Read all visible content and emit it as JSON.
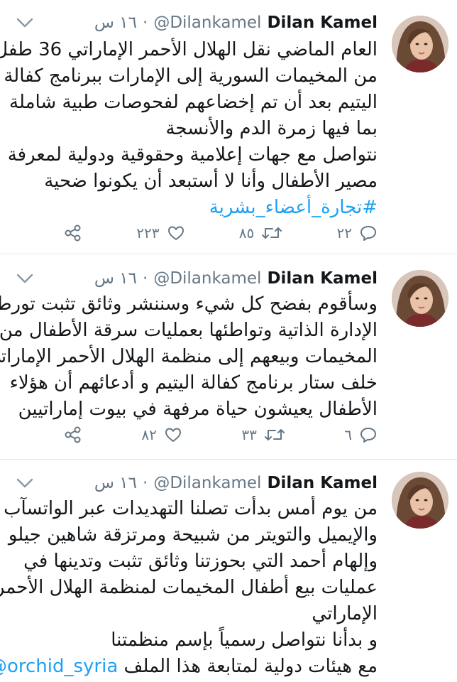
{
  "colors": {
    "link": "#1da1f2",
    "secondary_text": "#657786",
    "primary_text": "#14171a",
    "divider": "#e1e8ed"
  },
  "icons": {
    "reply": "reply-icon",
    "retweet": "retweet-icon",
    "like": "like-icon",
    "share": "share-icon",
    "caret": "chevron-down-icon"
  },
  "tweets": [
    {
      "display_name": "Dilan Kamel",
      "handle": "@Dilankamel",
      "dot": "·",
      "time": "١٦ س",
      "lines": [
        "العام الماضي نقل الهلال الأحمر الإماراتي 36 طفل",
        "من المخيمات السورية إلى الإمارات ببرنامج كفالة",
        "اليتيم بعد أن تم إخضاعهم لفحوصات طبية شاملة",
        "بما فيها زمرة الدم والأنسجة",
        "نتواصل مع جهات إعلامية وحقوقية ودولية لمعرفة",
        "مصير الأطفال وأنا لا أستبعد أن يكونوا ضحية"
      ],
      "hashtag": "#تجارة_أعضاء_بشرية",
      "replies": "٢٢",
      "retweets": "٨٥",
      "likes": "٢٢٣"
    },
    {
      "display_name": "Dilan Kamel",
      "handle": "@Dilankamel",
      "dot": "·",
      "time": "١٦ س",
      "lines": [
        "وسأقوم بفضح كل شيء وسننشر وثائق تثبت تورط",
        "الإدارة الذاتية وتواطئها بعمليات سرقة الأطفال من",
        "المخيمات وبيعهم إلى منظمة الهلال الأحمر الإماراتي",
        "خلف ستار برنامج كفالة اليتيم و أدعائهم أن هؤلاء",
        "الأطفال يعيشون حياة مرفهة في بيوت إماراتيين"
      ],
      "replies": "٦",
      "retweets": "٣٣",
      "likes": "٨٢"
    },
    {
      "display_name": "Dilan Kamel",
      "handle": "@Dilankamel",
      "dot": "·",
      "time": "١٦ س",
      "lines": [
        "من يوم أمس بدأت تصلنا التهديدات عبر الواتسآب",
        "والإيميل والتويتر من شبيحة ومرتزقة شاهين جيلو",
        "وإلهام أحمد التي بحوزتنا وثائق تثبت وتدينها في",
        "عمليات بيع أطفال المخيمات لمنظمة الهلال الأحمر",
        "الإماراتي",
        "و بدأنا نتواصل رسمياً بإسم منظمتنا"
      ],
      "last_line_text": "مع هيئات دولية لمتابعة هذا الملف",
      "last_line_mention": "@orchid_syria"
    }
  ]
}
